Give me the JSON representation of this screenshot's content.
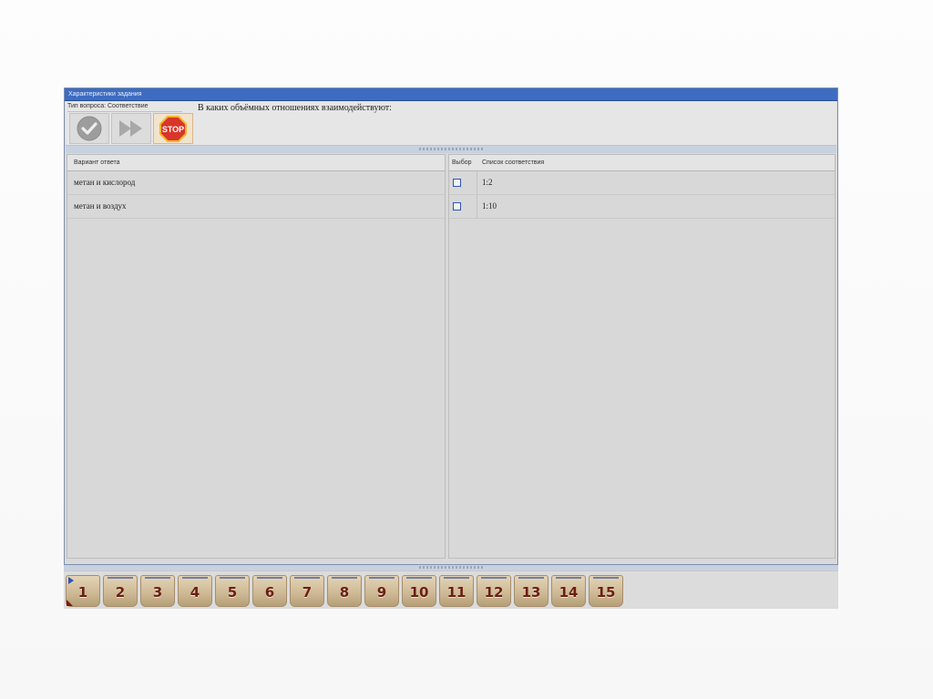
{
  "window": {
    "title": "Характеристики задания"
  },
  "toolbar": {
    "question_type": "Тип вопроса: Соответствие",
    "stop_label": "STOP"
  },
  "question": {
    "text": "В каких объёмных отношениях взаимодействуют:"
  },
  "left_grid": {
    "header": "Вариант ответа",
    "rows": [
      {
        "text": "метан и кислород"
      },
      {
        "text": "метан и воздух"
      }
    ]
  },
  "right_grid": {
    "header_choice": "Выбор",
    "header_list": "Список соответствия",
    "rows": [
      {
        "text": "1:2",
        "checked": false
      },
      {
        "text": "1:10",
        "checked": false
      }
    ]
  },
  "nav": {
    "active": "1",
    "buttons": [
      "1",
      "2",
      "3",
      "4",
      "5",
      "6",
      "7",
      "8",
      "9",
      "10",
      "11",
      "12",
      "13",
      "14",
      "15"
    ]
  },
  "colors": {
    "titlebar": "#3d6cc0",
    "nav_text": "#6b1f14",
    "stop_red": "#d9352a"
  }
}
